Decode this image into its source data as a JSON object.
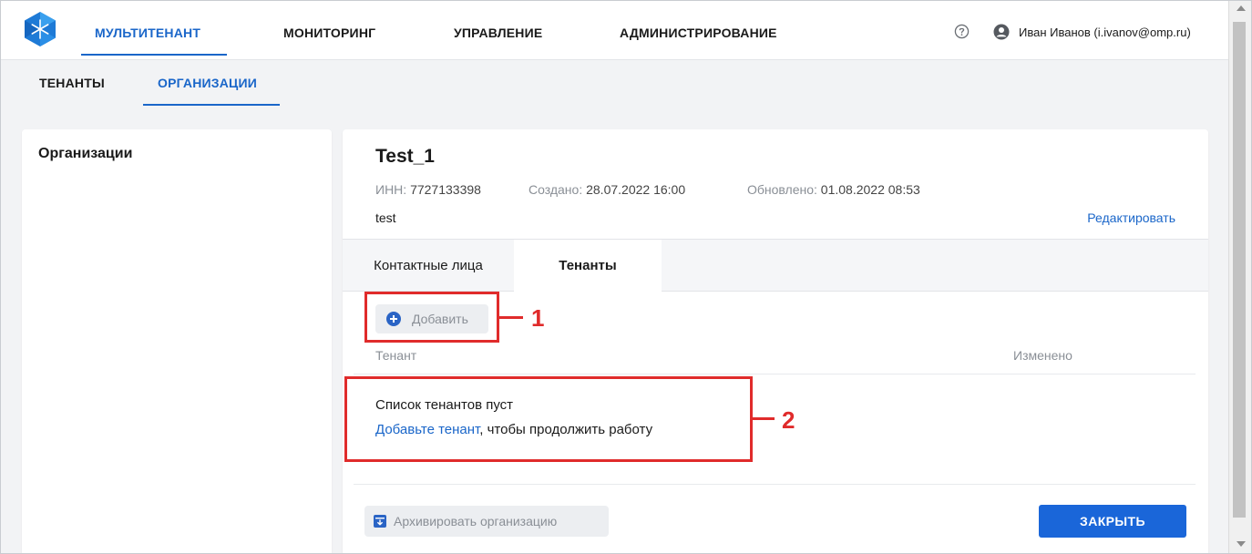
{
  "header": {
    "nav": [
      "МУЛЬТИТЕНАНТ",
      "МОНИТОРИНГ",
      "УПРАВЛЕНИЕ",
      "АДМИНИСТРИРОВАНИЕ"
    ],
    "user_name": "Иван Иванов (i.ivanov@omp.ru)",
    "active_color": "#1a66c9"
  },
  "subtabs": [
    "ТЕНАНТЫ",
    "ОРГАНИЗАЦИИ"
  ],
  "left_panel": {
    "title": "Организации"
  },
  "card": {
    "name": "Test_1",
    "inn_label": "ИНН:",
    "inn_value": "7727133398",
    "created_label": "Создано:",
    "created_value": "28.07.2022 16:00",
    "updated_label": "Обновлено:",
    "updated_value": "01.08.2022 08:53",
    "description": "test",
    "edit_label": "Редактировать",
    "tabs": [
      "Контактные лица",
      "Тенанты"
    ],
    "add_label": "Добавить",
    "columns": [
      "Тенант",
      "Изменено"
    ],
    "empty_title": "Список тенантов пуст",
    "empty_link": "Добавьте тенант",
    "empty_suffix": ", чтобы продолжить работу",
    "archive_label": "Архивировать организацию",
    "close_label": "ЗАКРЫТЬ"
  },
  "annotations": [
    "1",
    "2"
  ],
  "icons": [
    "app-logo-icon",
    "help-icon",
    "user-icon",
    "plus-circle-icon",
    "archive-icon"
  ]
}
